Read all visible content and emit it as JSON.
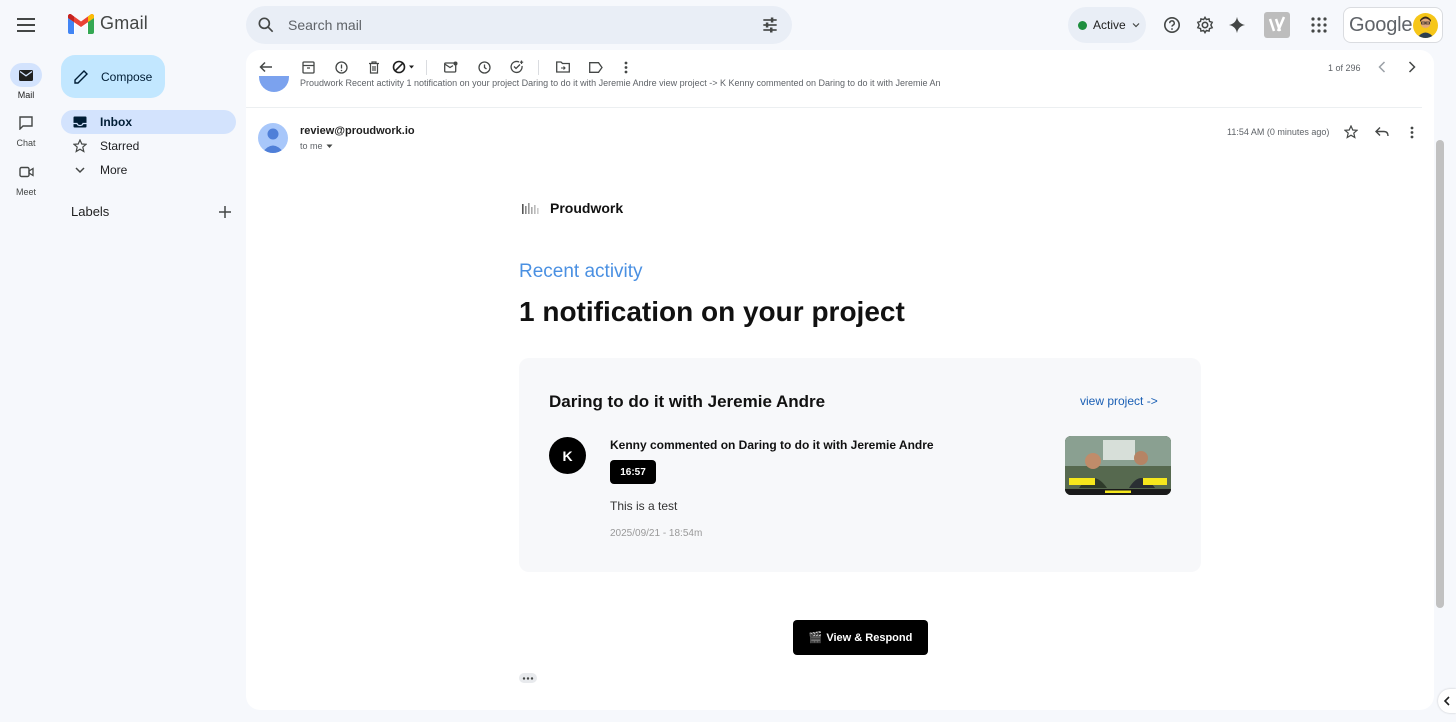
{
  "app": {
    "name": "Gmail"
  },
  "search": {
    "placeholder": "Search mail"
  },
  "status": {
    "label": "Active"
  },
  "account": {
    "brand": "Google"
  },
  "rail": [
    {
      "label": "Mail",
      "icon": "mail-icon"
    },
    {
      "label": "Chat",
      "icon": "chat-icon"
    },
    {
      "label": "Meet",
      "icon": "meet-icon"
    }
  ],
  "sidebar": {
    "compose_label": "Compose",
    "items": [
      {
        "label": "Inbox",
        "icon": "inbox-icon"
      },
      {
        "label": "Starred",
        "icon": "star-icon"
      },
      {
        "label": "More",
        "icon": "chevron-down-icon"
      }
    ],
    "labels_title": "Labels"
  },
  "toolbar": {
    "pager": "1 of 296"
  },
  "thread": {
    "preview_strip": "Proudwork Recent activity 1 notification on your project Daring to do it with Jeremie Andre view project -> K Kenny commented on Daring to do it with Jeremie An"
  },
  "message": {
    "sender": "review@proudwork.io",
    "to": "to me",
    "time": "11:54 AM (0 minutes ago)"
  },
  "email": {
    "brand": "Proudwork",
    "section_label": "Recent activity",
    "headline": "1 notification on your project",
    "project_title": "Daring to do it with Jeremie Andre",
    "view_project_link": "view project ->",
    "comment": {
      "avatar_initial": "K",
      "heading": "Kenny commented on Daring to do it with Jeremie Andre",
      "timestamp": "16:57",
      "text": "This is a test",
      "date": "2025/09/21 - 18:54m"
    },
    "cta_emoji": "🎬",
    "cta_label": "View & Respond"
  },
  "colors": {
    "accent_blue": "#4a90e2",
    "compose_bg": "#c2e7ff",
    "selected_bg": "#d3e3fd",
    "status_green": "#1e8e3e"
  }
}
